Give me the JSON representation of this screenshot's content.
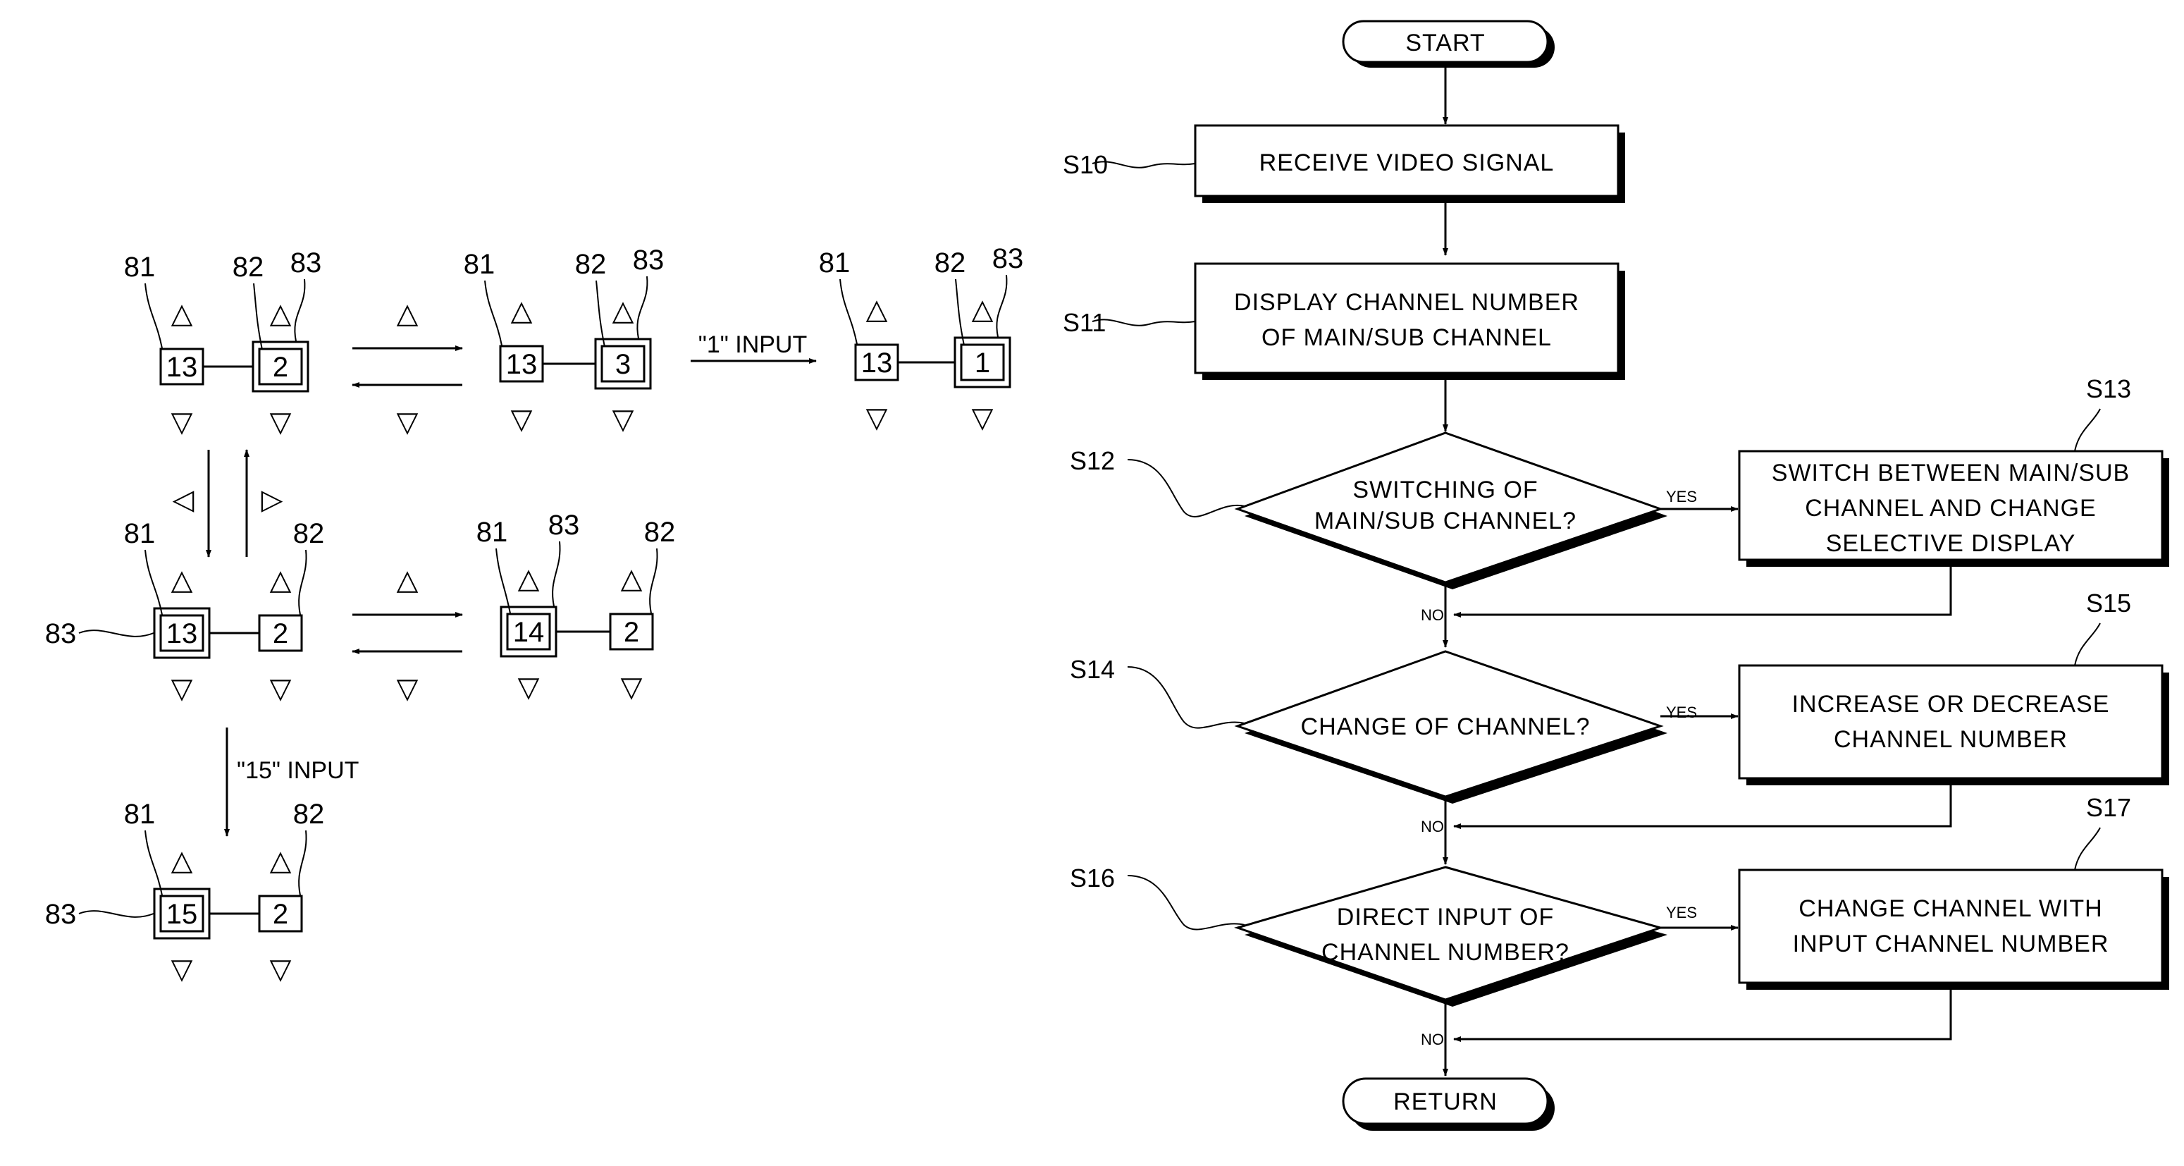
{
  "left_figure": {
    "ref_labels": {
      "main": "81",
      "sub": "82",
      "focus": "83"
    },
    "states": [
      {
        "id": "state-a",
        "main_value": "13",
        "sub_value": "2",
        "focused": "sub"
      },
      {
        "id": "state-b",
        "main_value": "13",
        "sub_value": "3",
        "focused": "sub"
      },
      {
        "id": "state-c",
        "main_value": "13",
        "sub_value": "1",
        "focused": "sub"
      },
      {
        "id": "state-d",
        "main_value": "13",
        "sub_value": "2",
        "focused": "main"
      },
      {
        "id": "state-e",
        "main_value": "14",
        "sub_value": "2",
        "focused": "main"
      },
      {
        "id": "state-f",
        "main_value": "15",
        "sub_value": "2",
        "focused": "main"
      }
    ],
    "transitions": {
      "up_symbol": "△",
      "down_symbol": "▽",
      "left_symbol": "◁",
      "right_symbol": "▷",
      "input_1": "\"1\" INPUT",
      "input_15": "\"15\" INPUT"
    }
  },
  "flowchart": {
    "start": "START",
    "end": "RETURN",
    "yes": "YES",
    "no": "NO",
    "steps": [
      {
        "id": "S10",
        "type": "process",
        "lines": [
          "RECEIVE VIDEO SIGNAL"
        ]
      },
      {
        "id": "S11",
        "type": "process",
        "lines": [
          "DISPLAY CHANNEL NUMBER",
          "OF MAIN/SUB CHANNEL"
        ]
      },
      {
        "id": "S12",
        "type": "decision",
        "lines": [
          "SWITCHING OF",
          "MAIN/SUB CHANNEL?"
        ]
      },
      {
        "id": "S13",
        "type": "process",
        "lines": [
          "SWITCH BETWEEN MAIN/SUB",
          "CHANNEL AND CHANGE",
          "SELECTIVE DISPLAY"
        ]
      },
      {
        "id": "S14",
        "type": "decision",
        "lines": [
          "CHANGE OF CHANNEL?"
        ]
      },
      {
        "id": "S15",
        "type": "process",
        "lines": [
          "INCREASE OR DECREASE",
          "CHANNEL NUMBER"
        ]
      },
      {
        "id": "S16",
        "type": "decision",
        "lines": [
          "DIRECT INPUT OF",
          "CHANNEL NUMBER?"
        ]
      },
      {
        "id": "S17",
        "type": "process",
        "lines": [
          "CHANGE CHANNEL WITH",
          "INPUT CHANNEL NUMBER"
        ]
      }
    ]
  }
}
